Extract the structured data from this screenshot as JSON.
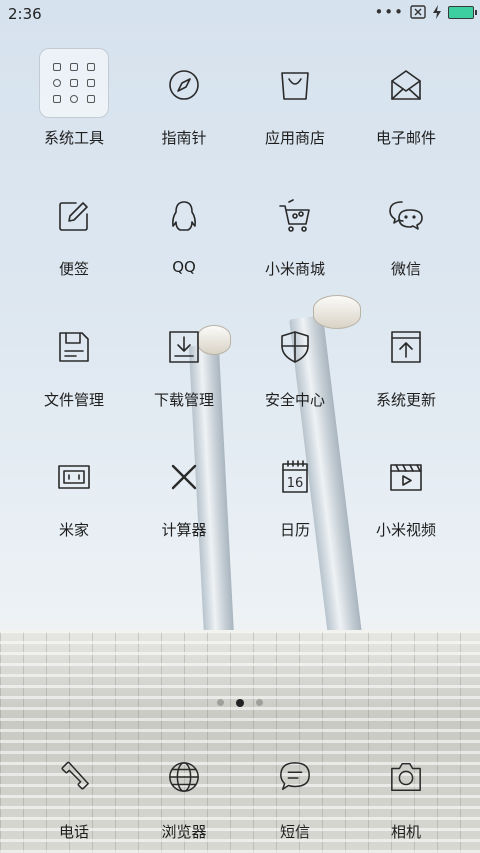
{
  "status": {
    "time": "2:36",
    "more": "•••"
  },
  "pager": {
    "pages": 3,
    "active": 1
  },
  "apps": [
    {
      "label": "系统工具",
      "icon": "folder-icon"
    },
    {
      "label": "指南针",
      "icon": "compass-icon"
    },
    {
      "label": "应用商店",
      "icon": "shopping-bag-icon"
    },
    {
      "label": "电子邮件",
      "icon": "envelope-icon"
    },
    {
      "label": "便签",
      "icon": "notes-pencil-icon"
    },
    {
      "label": "QQ",
      "icon": "qq-penguin-icon"
    },
    {
      "label": "小米商城",
      "icon": "shopping-cart-icon"
    },
    {
      "label": "微信",
      "icon": "wechat-icon"
    },
    {
      "label": "文件管理",
      "icon": "file-folder-icon"
    },
    {
      "label": "下载管理",
      "icon": "download-icon"
    },
    {
      "label": "安全中心",
      "icon": "shield-icon"
    },
    {
      "label": "系统更新",
      "icon": "update-arrow-icon"
    },
    {
      "label": "米家",
      "icon": "mi-home-device-icon"
    },
    {
      "label": "计算器",
      "icon": "calculator-x-icon"
    },
    {
      "label": "日历",
      "icon": "calendar-icon",
      "day": "16"
    },
    {
      "label": "小米视频",
      "icon": "video-clapper-icon"
    }
  ],
  "dock": [
    {
      "label": "电话",
      "icon": "phone-icon"
    },
    {
      "label": "浏览器",
      "icon": "globe-icon"
    },
    {
      "label": "短信",
      "icon": "message-bubble-icon"
    },
    {
      "label": "相机",
      "icon": "camera-icon"
    }
  ]
}
